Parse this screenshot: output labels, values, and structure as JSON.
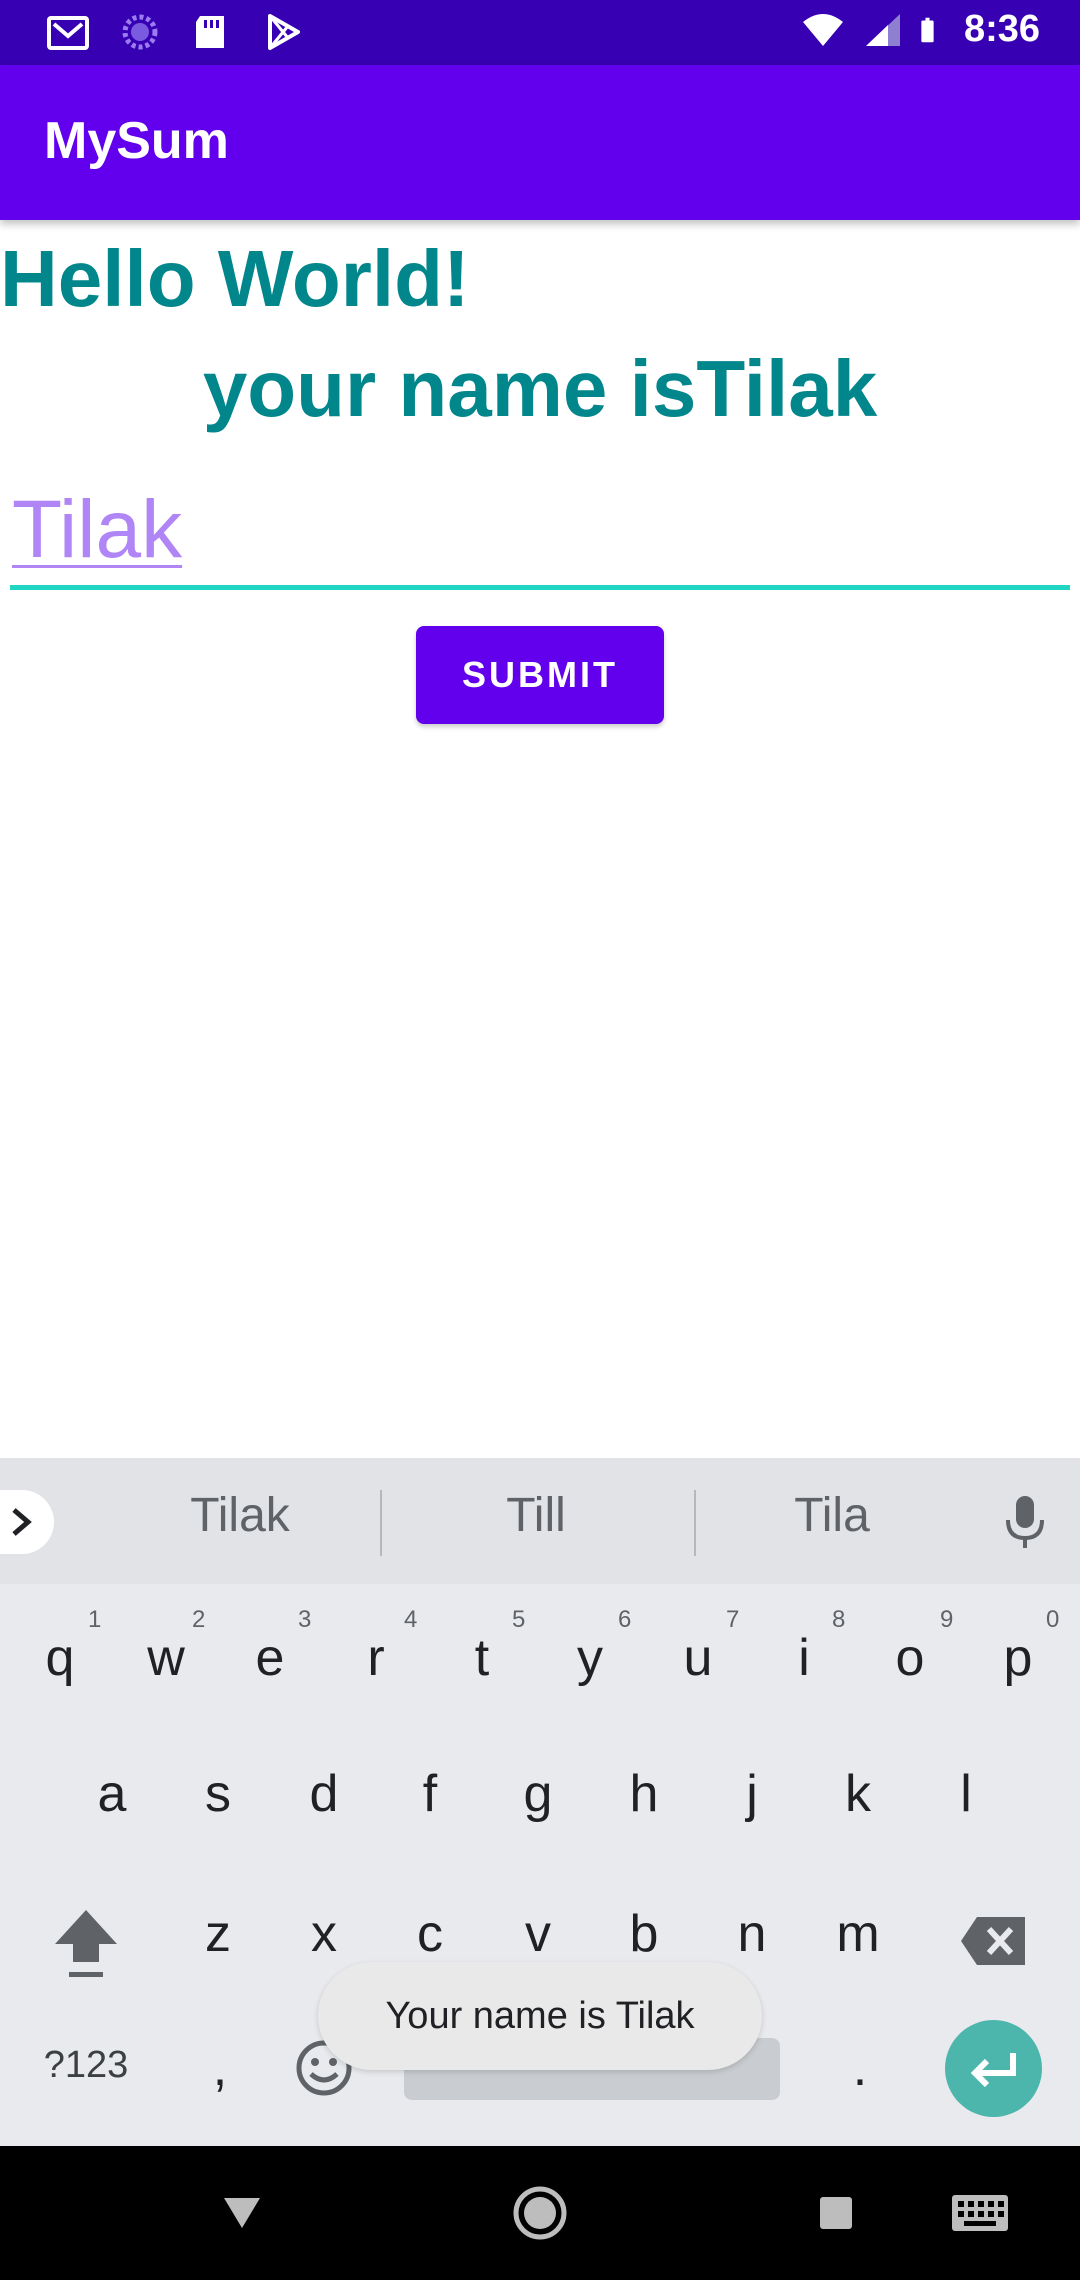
{
  "status_bar": {
    "time": "8:36",
    "left_icons": [
      "gmail-icon",
      "sync-icon",
      "sd-card-icon",
      "play-store-icon"
    ],
    "right_icons": [
      "wifi-icon",
      "signal-icon",
      "battery-icon"
    ]
  },
  "app_bar": {
    "title": "MySum"
  },
  "content": {
    "hello": "Hello World!",
    "your_name": "your name isTilak",
    "input_value": "Tilak",
    "submit_label": "SUBMIT"
  },
  "keyboard": {
    "suggestions": [
      "Tilak",
      "Till",
      "Tila"
    ],
    "row1": [
      "q",
      "w",
      "e",
      "r",
      "t",
      "y",
      "u",
      "i",
      "o",
      "p"
    ],
    "row1_nums": [
      "1",
      "2",
      "3",
      "4",
      "5",
      "6",
      "7",
      "8",
      "9",
      "0"
    ],
    "row2": [
      "a",
      "s",
      "d",
      "f",
      "g",
      "h",
      "j",
      "k",
      "l"
    ],
    "row3": [
      "z",
      "x",
      "c",
      "v",
      "b",
      "n",
      "m"
    ],
    "symbols_label": "?123",
    "comma": ",",
    "period": "."
  },
  "toast": {
    "message": "Your name is Tilak"
  },
  "colors": {
    "status_bar": "#3700b3",
    "app_bar": "#6200ee",
    "heading_teal": "#00868b",
    "input_text": "#b085f5",
    "input_underline": "#1fd6c2",
    "enter_key": "#4db6ac"
  }
}
